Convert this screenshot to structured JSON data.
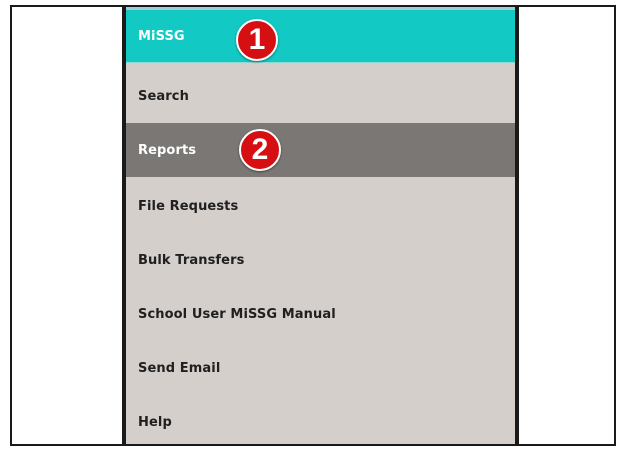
{
  "menu": {
    "items": [
      {
        "label": "MiSSG",
        "state": "header"
      },
      {
        "label": "Search",
        "state": "normal"
      },
      {
        "label": "Reports",
        "state": "active"
      },
      {
        "label": "File Requests",
        "state": "normal"
      },
      {
        "label": "Bulk Transfers",
        "state": "normal"
      },
      {
        "label": "School User MiSSG Manual",
        "state": "normal"
      },
      {
        "label": "Send Email",
        "state": "normal"
      },
      {
        "label": "Help",
        "state": "normal"
      }
    ]
  },
  "callouts": {
    "first": "1",
    "second": "2"
  },
  "colors": {
    "header_bg": "#12c9c4",
    "active_bg": "#7a7775",
    "menu_bg": "#d5cfcc",
    "badge_red": "#d50f12",
    "border": "#1a1a1a"
  }
}
